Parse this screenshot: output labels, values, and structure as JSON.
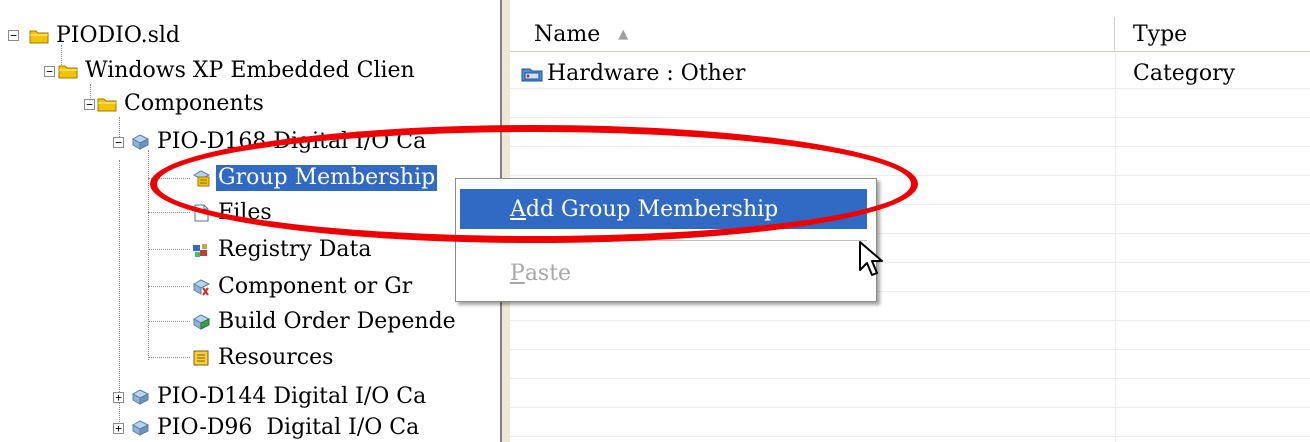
{
  "tree": {
    "nodes": [
      {
        "id": "root",
        "label": "PIODIO.sld",
        "icon": "folder-icon"
      },
      {
        "id": "client",
        "label": "Windows XP Embedded Clien",
        "icon": "folder-icon"
      },
      {
        "id": "components",
        "label": "Components",
        "icon": "folder-icon"
      },
      {
        "id": "d168",
        "label": "PIO-D168 Digital I/O Ca",
        "icon": "component-icon"
      },
      {
        "id": "group",
        "label": "Group Membership",
        "icon": "group-membership-icon"
      },
      {
        "id": "files",
        "label": "Files",
        "icon": "file-icon"
      },
      {
        "id": "registry",
        "label": "Registry Data",
        "icon": "registry-icon"
      },
      {
        "id": "compgroup",
        "label": "Component or Gr",
        "icon": "dependency-icon"
      },
      {
        "id": "build",
        "label": "Build Order Depende",
        "icon": "build-order-icon"
      },
      {
        "id": "resources",
        "label": "Resources",
        "icon": "resources-icon"
      },
      {
        "id": "d144",
        "label": "PIO-D144 Digital I/O Ca",
        "icon": "component-icon"
      },
      {
        "id": "d96",
        "label": "PIO-D96  Digital I/O Ca",
        "icon": "component-icon"
      }
    ]
  },
  "list": {
    "columns": [
      "Name",
      "Type"
    ],
    "rows": [
      {
        "name": "Hardware : Other",
        "type": "Category",
        "icon": "category-icon"
      }
    ]
  },
  "context_menu": {
    "items": [
      {
        "label": "Add Group Membership",
        "mnemonic": "A",
        "rest": "dd Group Membership",
        "state": "highlighted"
      },
      {
        "label": "Paste",
        "mnemonic": "P",
        "rest": "aste",
        "state": "disabled"
      }
    ]
  },
  "colors": {
    "selection": "#316ac5",
    "annotation_oval": "#ee0000",
    "folder": "#f5c400"
  }
}
